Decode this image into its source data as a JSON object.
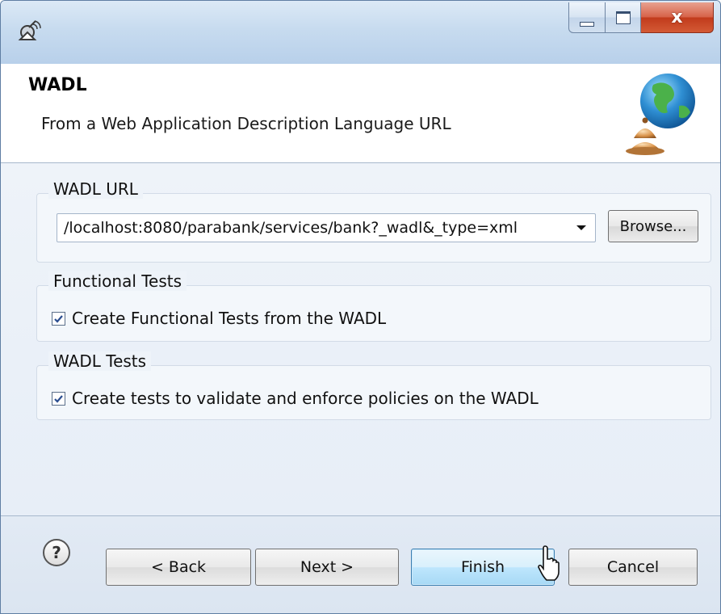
{
  "window": {
    "controls": {
      "minimize": "minimize",
      "maximize": "maximize",
      "close": "x"
    }
  },
  "banner": {
    "title": "WADL",
    "description": "From a Web Application Description Language URL"
  },
  "url_group": {
    "label": "WADL URL",
    "url_value": "/localhost:8080/parabank/services/bank?_wadl&_type=xml",
    "browse_label": "Browse..."
  },
  "functional_group": {
    "label": "Functional Tests",
    "checkbox_label": "Create Functional Tests from the WADL",
    "checked": true
  },
  "wadl_group": {
    "label": "WADL Tests",
    "checkbox_label": "Create tests to validate and enforce policies on the WADL",
    "checked": true
  },
  "footer": {
    "help_glyph": "?",
    "back_label": "< Back",
    "next_label": "Next >",
    "finish_label": "Finish",
    "cancel_label": "Cancel"
  },
  "colors": {
    "focused_button": "#bee6fd",
    "close_button": "#c23b1c",
    "title_bar": "#c7dbef"
  },
  "icons": [
    "app-satellite-icon",
    "globe-icon",
    "help-icon",
    "checkmark-icon",
    "dropdown-arrow-icon",
    "mouse-cursor-icon"
  ]
}
